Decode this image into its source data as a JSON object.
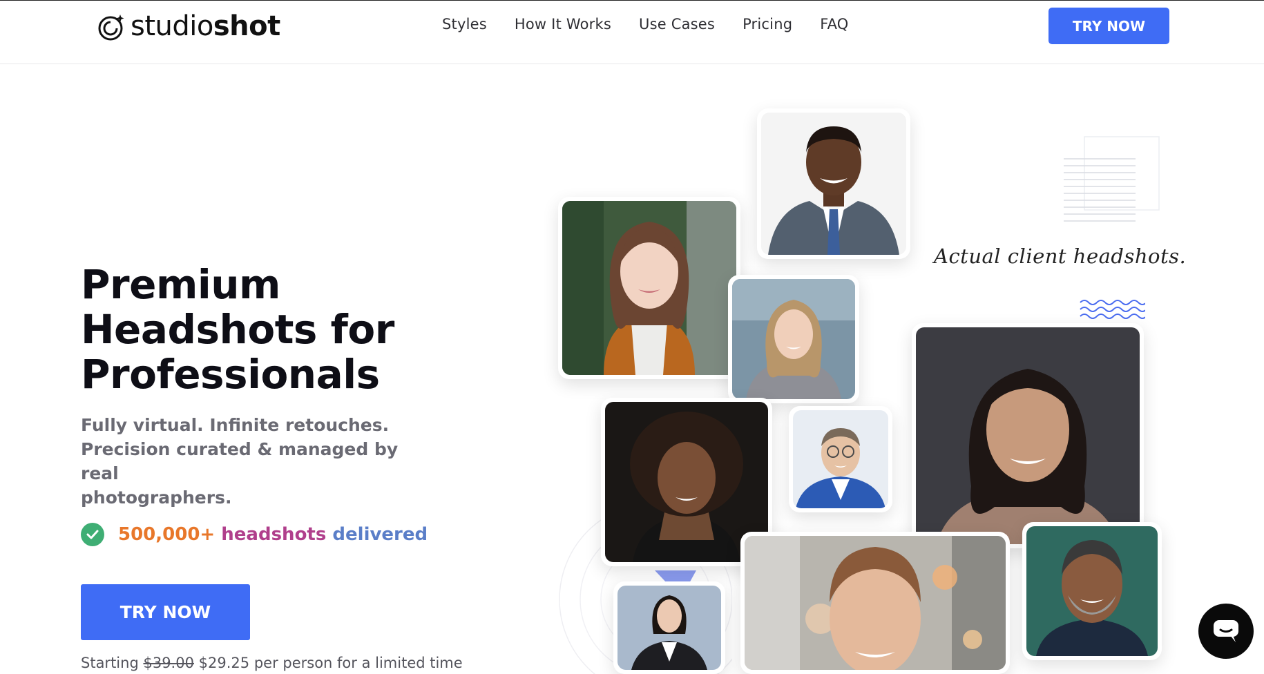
{
  "header": {
    "logo": {
      "text_light": "studio",
      "text_bold": "shot",
      "icon": "camera-lens-icon"
    },
    "nav": [
      "Styles",
      "How It Works",
      "Use Cases",
      "Pricing",
      "FAQ"
    ],
    "cta_label": "TRY NOW"
  },
  "hero": {
    "title_lines": [
      "Premium",
      "Headshots for",
      "Professionals"
    ],
    "subtitle_lines": [
      "Fully virtual. Infinite retouches.",
      "Precision curated & managed by real",
      "photographers."
    ],
    "stat": {
      "icon": "check-circle-icon",
      "number": "500,000+",
      "word1": "headshots",
      "word2": "delivered"
    },
    "cta_label": "TRY NOW",
    "price": {
      "prefix": "Starting",
      "old": "$39.00",
      "new": "$29.25",
      "suffix": "per person for a limited time"
    }
  },
  "gallery": {
    "caption": "Actual client headshots.",
    "photos": [
      {
        "name": "photo-man-suit-blue-tie"
      },
      {
        "name": "photo-woman-orange-jacket"
      },
      {
        "name": "photo-woman-blonde"
      },
      {
        "name": "photo-woman-curly-hair"
      },
      {
        "name": "photo-man-glasses"
      },
      {
        "name": "photo-woman-dark-hair-smiling"
      },
      {
        "name": "photo-woman-business-suit"
      },
      {
        "name": "photo-man-smiling-bokeh"
      },
      {
        "name": "photo-man-grey-beard"
      }
    ]
  },
  "chat": {
    "icon": "chat-bubble-icon"
  },
  "colors": {
    "accent": "#3f6cf5",
    "check": "#3fae74",
    "heading": "#0e0e16"
  }
}
